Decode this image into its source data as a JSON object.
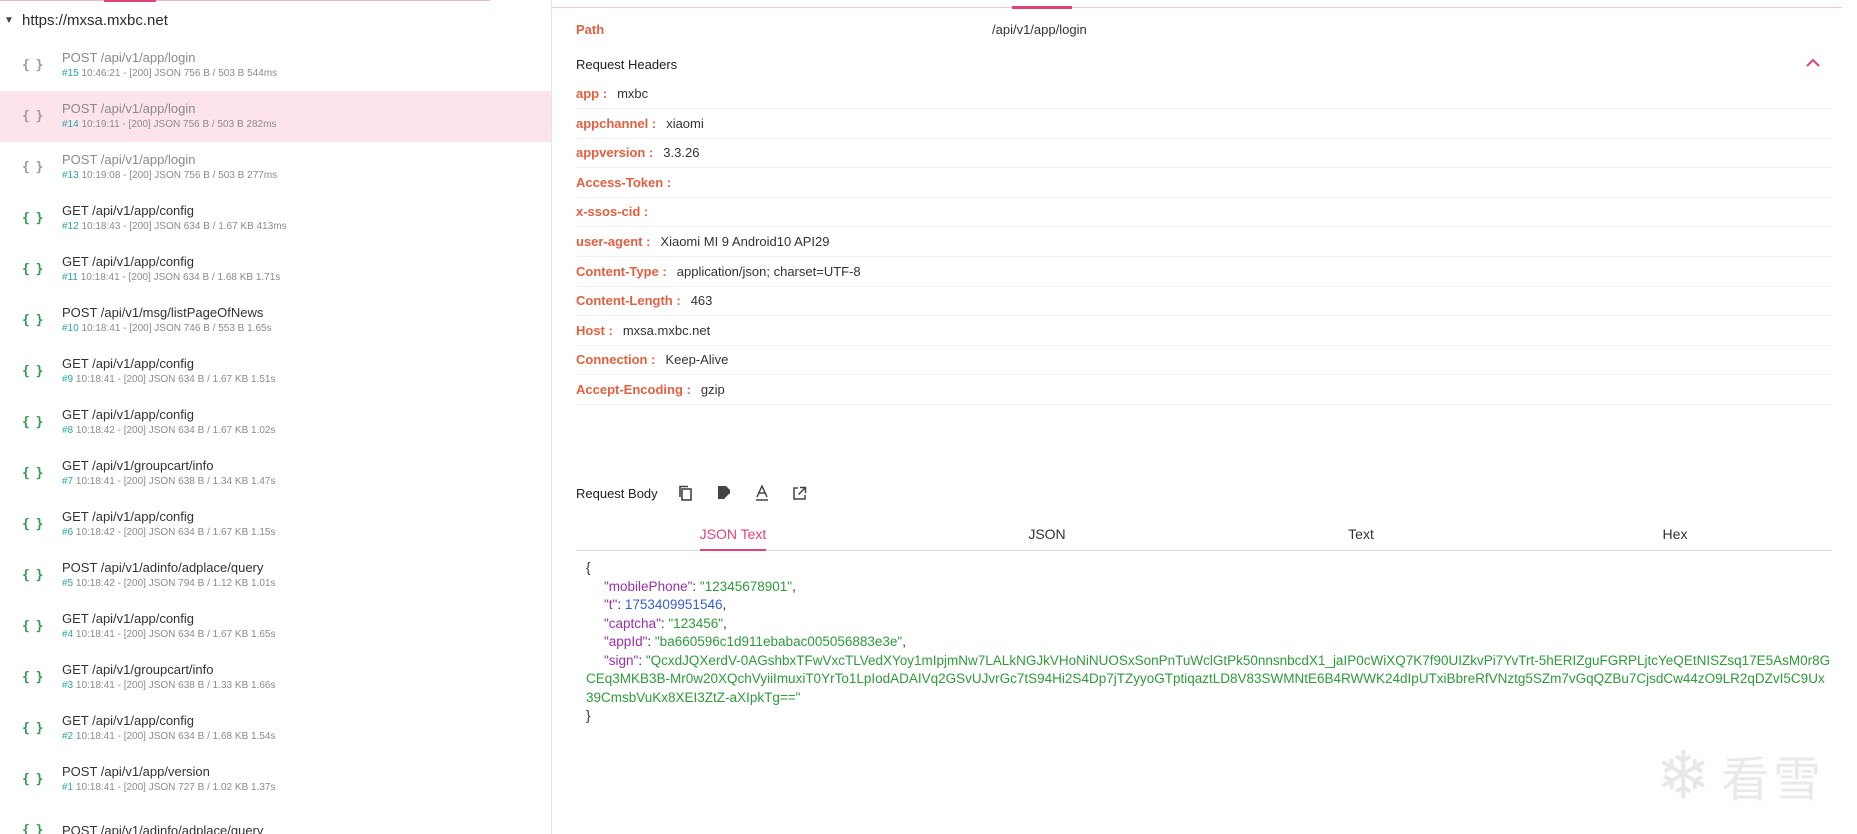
{
  "sidebar": {
    "host": "https://mxsa.mxbc.net",
    "requests": [
      {
        "line1": "POST /api/v1/app/login",
        "num": "#15",
        "meta": "10:46:21 - [200]  JSON 756 B / 503 B  544ms"
      },
      {
        "line1": "POST /api/v1/app/login",
        "num": "#14",
        "meta": "10:19:11 - [200]  JSON 756 B / 503 B  282ms"
      },
      {
        "line1": "POST /api/v1/app/login",
        "num": "#13",
        "meta": "10:19:08 - [200]  JSON 756 B / 503 B  277ms"
      },
      {
        "line1": "GET /api/v1/app/config",
        "num": "#12",
        "meta": "10:18:43 - [200]  JSON 634 B / 1.67 KB  413ms"
      },
      {
        "line1": "GET /api/v1/app/config",
        "num": "#11",
        "meta": "10:18:41 - [200]  JSON 634 B / 1.68 KB  1.71s"
      },
      {
        "line1": "POST /api/v1/msg/listPageOfNews",
        "num": "#10",
        "meta": "10:18:41 - [200]  JSON 746 B / 553 B  1.65s"
      },
      {
        "line1": "GET /api/v1/app/config",
        "num": "#9",
        "meta": "10:18:41 - [200]  JSON 634 B / 1.67 KB  1.51s"
      },
      {
        "line1": "GET /api/v1/app/config",
        "num": "#8",
        "meta": "10:18:42 - [200]  JSON 634 B / 1.67 KB  1.02s"
      },
      {
        "line1": "GET /api/v1/groupcart/info",
        "num": "#7",
        "meta": "10:18:41 - [200]  JSON 638 B / 1.34 KB  1.47s"
      },
      {
        "line1": "GET /api/v1/app/config",
        "num": "#6",
        "meta": "10:18:42 - [200]  JSON 634 B / 1.67 KB  1.15s"
      },
      {
        "line1": "POST /api/v1/adinfo/adplace/query",
        "num": "#5",
        "meta": "10:18:42 - [200]  JSON 794 B / 1.12 KB  1.01s"
      },
      {
        "line1": "GET /api/v1/app/config",
        "num": "#4",
        "meta": "10:18:41 - [200]  JSON 634 B / 1.67 KB  1.65s"
      },
      {
        "line1": "GET /api/v1/groupcart/info",
        "num": "#3",
        "meta": "10:18:41 - [200]  JSON 638 B / 1.33 KB  1.66s"
      },
      {
        "line1": "GET /api/v1/app/config",
        "num": "#2",
        "meta": "10:18:41 - [200]  JSON 634 B / 1.68 KB  1.54s"
      },
      {
        "line1": "POST /api/v1/app/version",
        "num": "#1",
        "meta": "10:18:41 - [200]  JSON 727 B / 1.02 KB  1.37s"
      },
      {
        "line1": "POST /api/v1/adinfo/adplace/query",
        "num": "",
        "meta": ""
      }
    ]
  },
  "detail": {
    "path_label": "Path",
    "path_value": "/api/v1/app/login",
    "headers_title": "Request Headers",
    "headers": [
      {
        "key": "app :",
        "value": "mxbc"
      },
      {
        "key": "appchannel :",
        "value": "xiaomi"
      },
      {
        "key": "appversion :",
        "value": "3.3.26"
      },
      {
        "key": "Access-Token :",
        "value": ""
      },
      {
        "key": "x-ssos-cid :",
        "value": ""
      },
      {
        "key": "user-agent :",
        "value": "Xiaomi MI 9 Android10 API29"
      },
      {
        "key": "Content-Type :",
        "value": "application/json; charset=UTF-8"
      },
      {
        "key": "Content-Length :",
        "value": "463"
      },
      {
        "key": "Host :",
        "value": "mxsa.mxbc.net"
      },
      {
        "key": "Connection :",
        "value": "Keep-Alive"
      },
      {
        "key": "Accept-Encoding :",
        "value": "gzip"
      }
    ],
    "body_title": "Request Body",
    "tabs": [
      "JSON Text",
      "JSON",
      "Text",
      "Hex"
    ],
    "json": {
      "open": "{",
      "close": "}",
      "mobilePhone_key": "\"mobilePhone\"",
      "mobilePhone_val": "\"12345678901\"",
      "t_key": "\"t\"",
      "t_val": "1753409951546",
      "captcha_key": "\"captcha\"",
      "captcha_val": "\"123456\"",
      "appId_key": "\"appId\"",
      "appId_val": "\"ba660596c1d911ebabac005056883e3e\"",
      "sign_key": "\"sign\"",
      "sign_val": "\"QcxdJQXerdV-0AGshbxTFwVxcTLVedXYoy1mIpjmNw7LALkNGJkVHoNiNUOSxSonPnTuWclGtPk50nnsnbcdX1_jaIP0cWiXQ7K7f90UIZkvPi7YvTrt-5hERIZguFGRPLjtcYeQEtNISZsq17E5AsM0r8GCEq3MKB3B-Mr0w20XQchVyiiImuxiT0YrTo1LpIodADAIVq2GSvUJvrGc7tS94Hi2S4Dp7jTZyyoGTptiqaztLD8V83SWMNtE6B4RWWK24dIpUTxiBbreRfVNztg5SZm7vGqQZBu7CjsdCw44zO9LR2qDZvI5C9Ux39CmsbVuKx8XEI3ZtZ-aXIpkTg==\""
    }
  },
  "watermark": {
    "text": "看雪"
  }
}
